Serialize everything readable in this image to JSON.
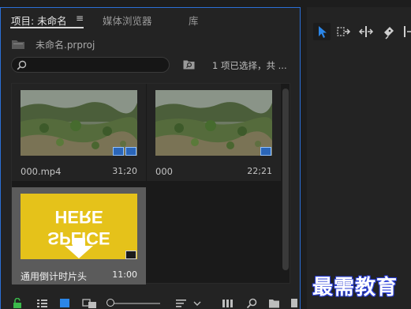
{
  "project_panel": {
    "tabs": [
      {
        "label": "项目: 未命名",
        "active": true
      },
      {
        "label": "媒体浏览器",
        "active": false
      },
      {
        "label": "库",
        "active": false
      }
    ],
    "tab_menu_glyph": "≡",
    "project_file": "未命名.prproj",
    "search": {
      "placeholder": "",
      "value": ""
    },
    "selection_status": "1 项已选择，共 ...",
    "clips": [
      {
        "name": "000.mp4",
        "duration": "31;20",
        "thumbnail": "grass-field",
        "selected": false,
        "badges": [
          "video-audio-icon",
          "audio-waveform-icon"
        ]
      },
      {
        "name": "000",
        "duration": "22;21",
        "thumbnail": "grass-field",
        "selected": false,
        "badges": [
          "sequence-icon"
        ]
      },
      {
        "name": "通用倒计时片头",
        "duration": "11:00",
        "thumbnail": "splice-here",
        "selected": true,
        "badges": [
          "audio-waveform-icon"
        ]
      }
    ],
    "thumbnail_text": {
      "line1": "HERE",
      "line2": "SPLICE"
    }
  },
  "tools_panel": {
    "tools": [
      {
        "name": "selection-tool",
        "active": true
      },
      {
        "name": "track-select-tool",
        "active": false
      },
      {
        "name": "ripple-edit-tool",
        "active": false
      },
      {
        "name": "razor-tool",
        "active": false
      },
      {
        "name": "slip-tool",
        "active": false
      }
    ]
  },
  "watermark": "最需教育",
  "colors": {
    "accent": "#2b6fd6",
    "thumbnail_yellow": "#e5c21a",
    "badge_blue": "#2a65b8",
    "lock_green": "#3ab84a"
  }
}
